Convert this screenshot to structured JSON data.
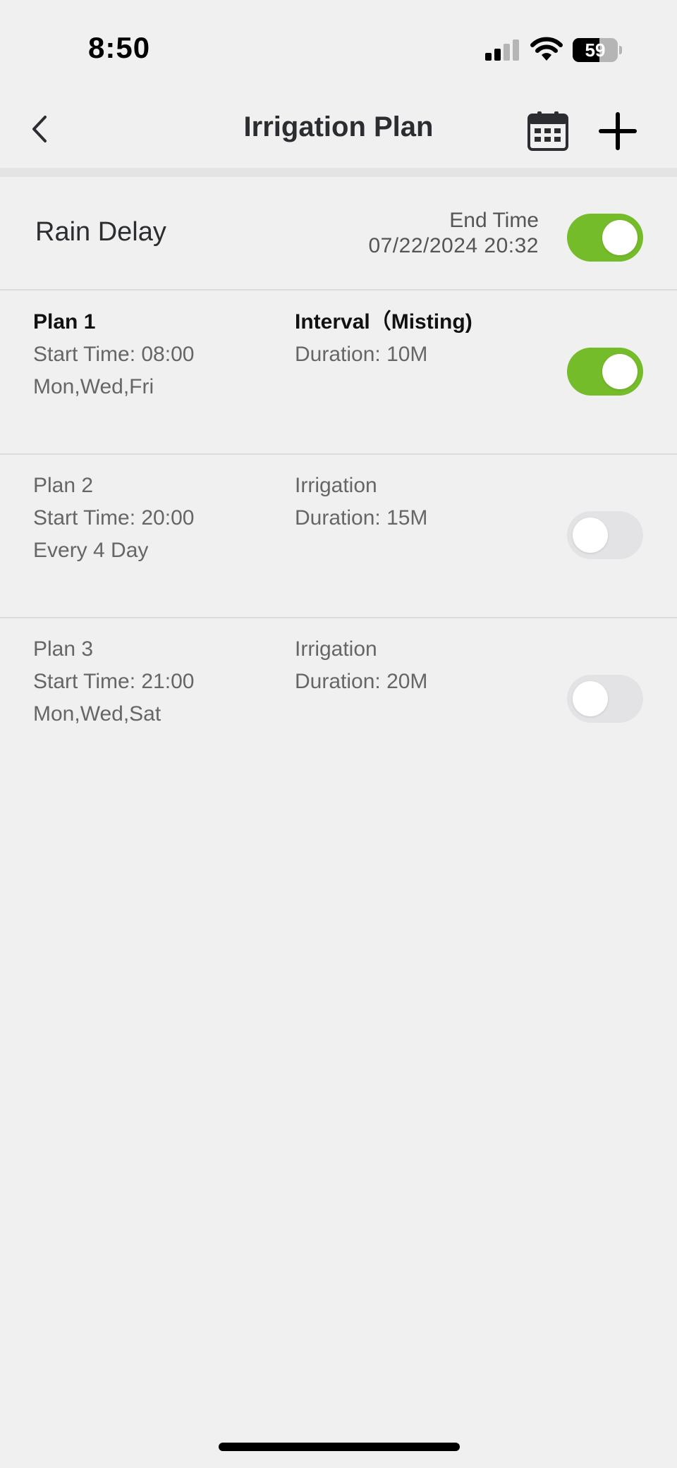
{
  "status_bar": {
    "time": "8:50",
    "battery": "59",
    "battery_level": 0.59
  },
  "header": {
    "title": "Irrigation Plan",
    "back_icon": "chevron-left-icon",
    "calendar_icon": "calendar-icon",
    "add_icon": "plus-icon"
  },
  "rain_delay": {
    "label": "Rain Delay",
    "end_time_label": "End Time",
    "end_time_value": "07/22/2024 20:32",
    "enabled": true
  },
  "plans": [
    {
      "name": "Plan 1",
      "start": "Start Time: 08:00",
      "schedule": "Mon,Wed,Fri",
      "type": "Interval（Misting)",
      "duration": "Duration: 10M",
      "enabled": true
    },
    {
      "name": "Plan 2",
      "start": "Start Time: 20:00",
      "schedule": "Every 4 Day",
      "type": "Irrigation",
      "duration": "Duration: 15M",
      "enabled": false
    },
    {
      "name": "Plan 3",
      "start": "Start Time: 21:00",
      "schedule": "Mon,Wed,Sat",
      "type": "Irrigation",
      "duration": "Duration: 20M",
      "enabled": false
    }
  ],
  "colors": {
    "background": "#f0f0f0",
    "toggle_on": "#74bc2a",
    "toggle_off": "#e3e3e6",
    "text_primary": "#2b2d31",
    "text_secondary": "#666666"
  }
}
